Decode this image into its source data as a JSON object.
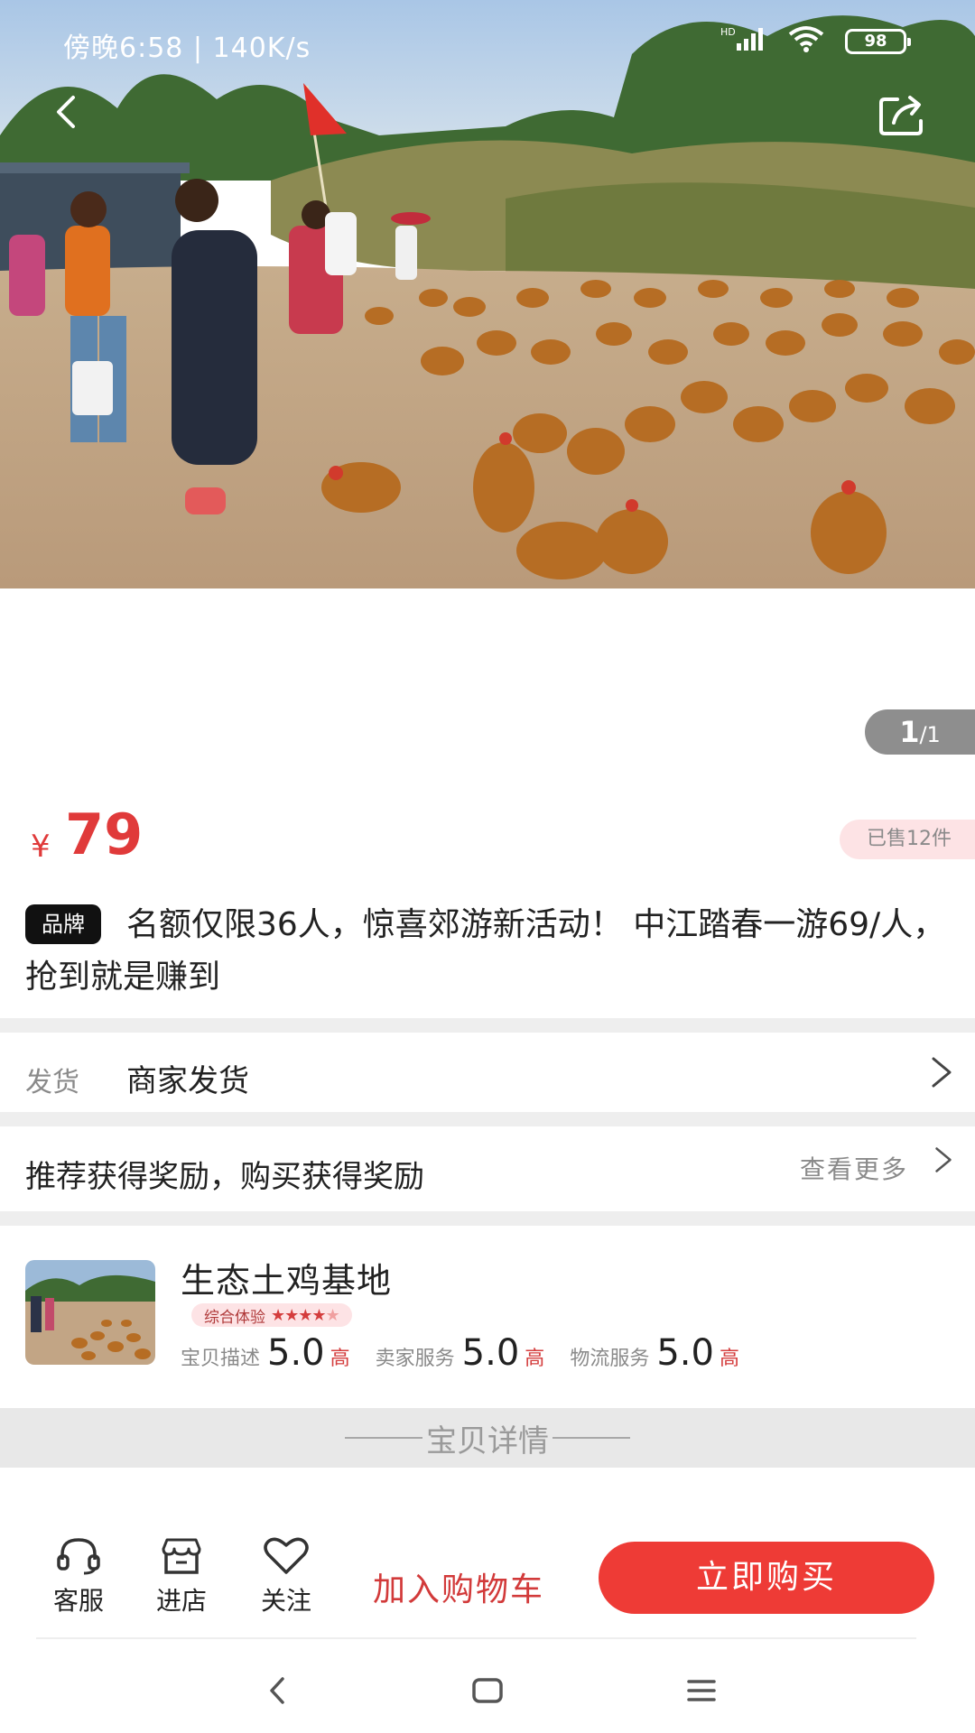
{
  "status_bar": {
    "time_speed": "傍晚6:58 | 140K/s",
    "signal": "HD",
    "battery": "98"
  },
  "gallery": {
    "current": "1",
    "total": "/1"
  },
  "price": {
    "currency": "¥",
    "amount": "79",
    "sold": "已售12件"
  },
  "title": {
    "brand_tag": "品牌",
    "text": "名额仅限36人，惊喜郊游新活动！ 中江踏春一游69/人，抢到就是赚到"
  },
  "shipping": {
    "label": "发货",
    "value": "商家发货"
  },
  "reward": {
    "text": "推荐获得奖励，购买获得奖励",
    "more": "查看更多"
  },
  "shop": {
    "name": "生态土鸡基地",
    "experience_label": "综合体验",
    "experience_stars": 4,
    "scores": [
      {
        "label": "宝贝描述",
        "value": "5.0",
        "level": "高"
      },
      {
        "label": "卖家服务",
        "value": "5.0",
        "level": "高"
      },
      {
        "label": "物流服务",
        "value": "5.0",
        "level": "高"
      }
    ]
  },
  "detail_header": "宝贝详情",
  "action_bar": {
    "service": "客服",
    "store": "进店",
    "follow": "关注",
    "add_to_cart": "加入购物车",
    "buy_now": "立即购买"
  },
  "colors": {
    "accent_red": "#ee3b36",
    "price_red": "#e03a3a",
    "muted_gray": "#8a8a8a"
  },
  "icons": [
    "back-arrow-icon",
    "share-icon",
    "headset-icon",
    "store-icon",
    "heart-icon",
    "chevron-right-icon",
    "nav-back-icon",
    "nav-home-icon",
    "nav-menu-icon"
  ]
}
